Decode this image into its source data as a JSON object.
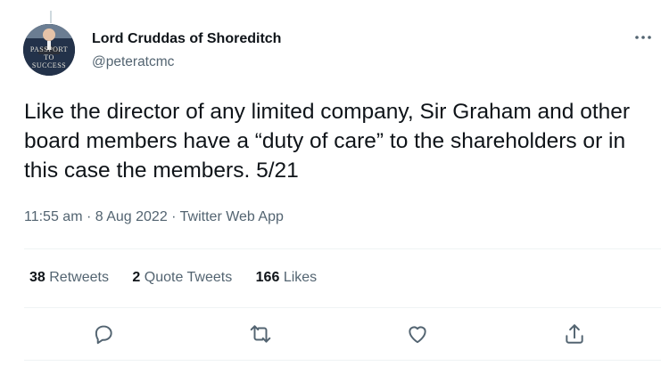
{
  "author": {
    "name": "Lord Cruddas of Shoreditch",
    "handle": "@peteratcmc",
    "avatar_text": [
      "PASSPORT",
      "TO",
      "SUCCESS"
    ]
  },
  "tweet": {
    "text": "Like the director of any limited company, Sir Graham and other board members have a “duty of care” to the shareholders or in this case the members. 5/21",
    "time": "11:55 am",
    "sep1": " · ",
    "date": "8 Aug 2022",
    "sep2": " · ",
    "source": "Twitter Web App"
  },
  "stats": {
    "retweets_count": "38",
    "retweets_label": "Retweets",
    "quotes_count": "2",
    "quotes_label": "Quote Tweets",
    "likes_count": "166",
    "likes_label": "Likes"
  },
  "icons": {
    "more": "more-icon",
    "reply": "reply-icon",
    "retweet": "retweet-icon",
    "like": "heart-icon",
    "share": "share-icon"
  },
  "colors": {
    "text": "#0f1419",
    "secondary": "#536471",
    "divider": "#eff3f4"
  }
}
